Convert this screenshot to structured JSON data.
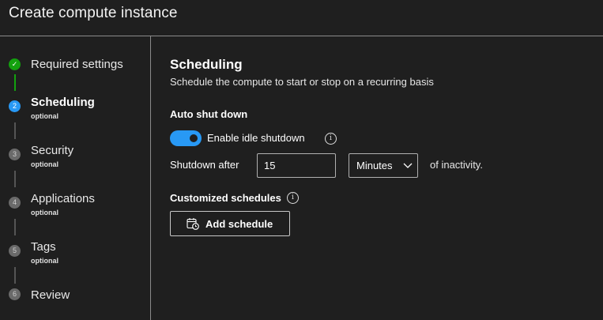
{
  "window": {
    "title": "Create compute instance"
  },
  "steps": [
    {
      "num": "✓",
      "label": "Required settings",
      "sub": "",
      "state": "done"
    },
    {
      "num": "2",
      "label": "Scheduling",
      "sub": "optional",
      "state": "active"
    },
    {
      "num": "3",
      "label": "Security",
      "sub": "optional",
      "state": "pending"
    },
    {
      "num": "4",
      "label": "Applications",
      "sub": "optional",
      "state": "pending"
    },
    {
      "num": "5",
      "label": "Tags",
      "sub": "optional",
      "state": "pending"
    },
    {
      "num": "6",
      "label": "Review",
      "sub": "",
      "state": "pending"
    }
  ],
  "scheduling": {
    "heading": "Scheduling",
    "description": "Schedule the compute to start or stop on a recurring basis"
  },
  "auto_shutdown": {
    "heading": "Auto shut down",
    "toggle_label": "Enable idle shutdown",
    "toggle_on": true,
    "info_glyph": "i",
    "prefix": "Shutdown after",
    "value": "15",
    "unit": "Minutes",
    "suffix": "of inactivity."
  },
  "custom_schedules": {
    "heading": "Customized schedules",
    "info_glyph": "i",
    "add_button": "Add schedule"
  },
  "colors": {
    "accent": "#2899f5",
    "success": "#13a10e",
    "background": "#1f1f1f"
  },
  "icons": {
    "step_done": "checkmark-icon",
    "info": "info-icon",
    "dropdown": "chevron-down-icon",
    "add_schedule": "calendar-clock-icon"
  }
}
